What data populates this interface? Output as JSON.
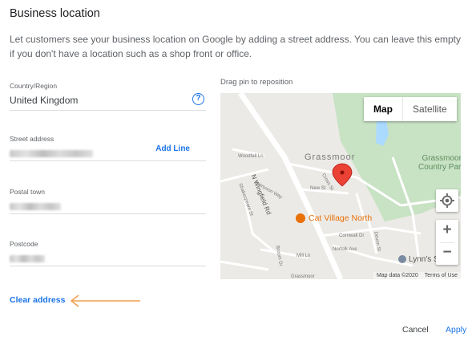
{
  "dialog": {
    "title": "Business location",
    "description": "Let customers see your business location on Google by adding a street address. You can leave this empty if you don't have a location such as a shop front or office."
  },
  "form": {
    "country": {
      "label": "Country/Region",
      "value": "United Kingdom",
      "icon": "help-icon"
    },
    "street": {
      "label": "Street address",
      "add_line_label": "Add Line"
    },
    "town": {
      "label": "Postal town"
    },
    "postcode": {
      "label": "Postcode"
    },
    "clear_label": "Clear address"
  },
  "map": {
    "instruction": "Drag pin to reposition",
    "type_buttons": [
      "Map",
      "Satellite"
    ],
    "active_type": "Map",
    "places": {
      "area": "Grassmoor",
      "park_line1": "Grassmoor",
      "park_line2": "Country Park",
      "poi_main": "Cat Village North",
      "poi_secondary": "Lynn's S"
    },
    "roads": {
      "main": "N Wingfield Rd",
      "streets": [
        "Woodfall Ln",
        "Cross St",
        "Tennyson Way",
        "Shakespeare St",
        "New St",
        "Cornwall Dr",
        "Mill Ln",
        "Norfolk Ave",
        "Devon St",
        "Broom Dr",
        "Grassmoor"
      ]
    },
    "controls": {
      "locate_icon": "locate-icon",
      "zoom_in": "+",
      "zoom_out": "−"
    },
    "attribution": {
      "data": "Map data ©2020",
      "terms": "Terms of Use"
    },
    "colors": {
      "pin": "#ea4335",
      "park": "#c8e2c4",
      "water": "#aadaff",
      "road": "#ffffff",
      "poi": "#e8710a"
    }
  },
  "actions": {
    "cancel": "Cancel",
    "apply": "Apply"
  },
  "colors": {
    "accent": "#1a73e8",
    "annotation_arrow": "#f0a050"
  }
}
